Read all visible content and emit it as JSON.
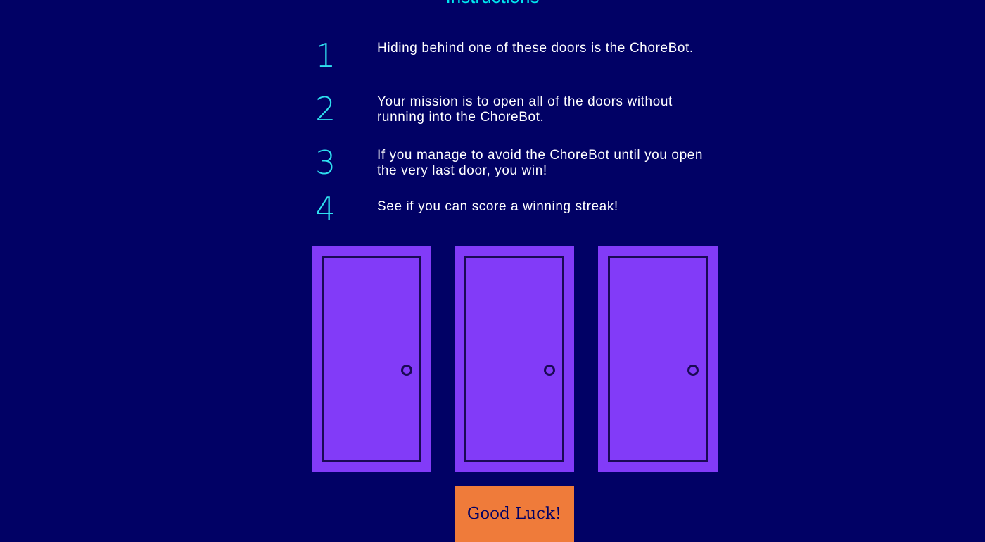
{
  "heading": "~ Instructions ~",
  "instructions": [
    {
      "number": "1",
      "text": "Hiding behind one of these doors is the ChoreBot."
    },
    {
      "number": "2",
      "text": "Your mission is to open all of the doors without running into the ChoreBot."
    },
    {
      "number": "3",
      "text": "If you manage to avoid the ChoreBot until you open the very last door, you win!"
    },
    {
      "number": "4",
      "text": "See if you can score a winning streak!"
    }
  ],
  "doors": [
    {
      "label": "door 1"
    },
    {
      "label": "door 2"
    },
    {
      "label": "door 3"
    }
  ],
  "start_button": {
    "label": "Good Luck!"
  },
  "colors": {
    "background": "#010165",
    "accent_cyan": "#2fe0f0",
    "door": "#823bf8",
    "door_outline": "#1a0a55",
    "button": "#ef7b3a"
  }
}
